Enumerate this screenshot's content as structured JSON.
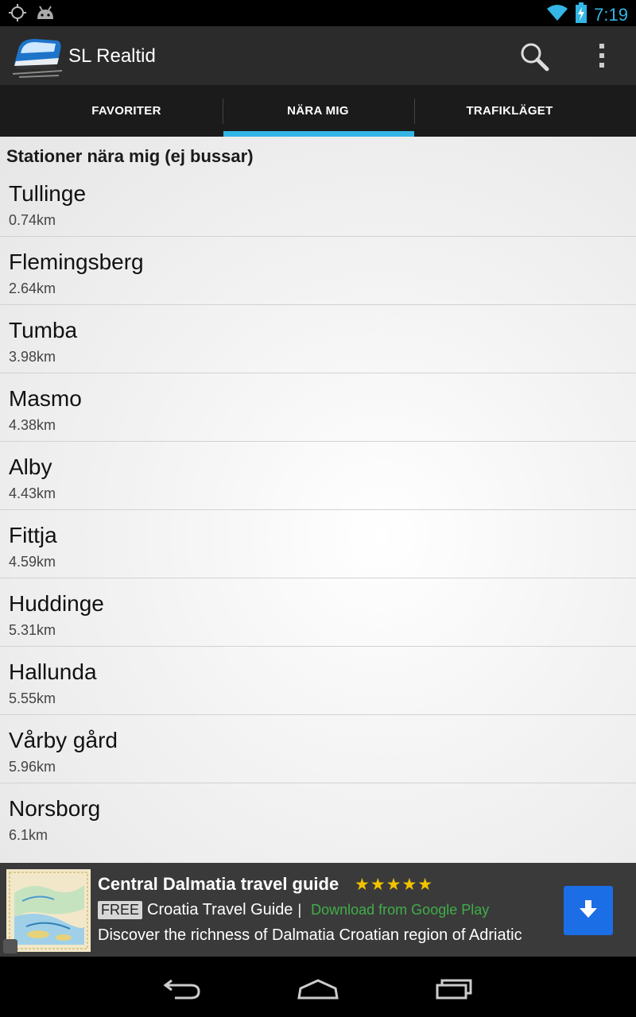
{
  "status_bar": {
    "time": "7:19",
    "left_icons": [
      "gps-icon",
      "android-icon"
    ],
    "right_icons": [
      "wifi-icon",
      "battery-charging-icon"
    ]
  },
  "action_bar": {
    "title": "SL Realtid",
    "actions": [
      "search-icon",
      "overflow-menu-icon"
    ]
  },
  "tabs": {
    "items": [
      {
        "label": "FAVORITER",
        "selected": false
      },
      {
        "label": "NÄRA MIG",
        "selected": true
      },
      {
        "label": "TRAFIKLÄGET",
        "selected": false
      }
    ],
    "accent": "#33b5e5"
  },
  "content": {
    "section_title": "Stationer nära mig (ej bussar)",
    "stations": [
      {
        "name": "Tullinge",
        "distance": "0.74km"
      },
      {
        "name": "Flemingsberg",
        "distance": "2.64km"
      },
      {
        "name": "Tumba",
        "distance": "3.98km"
      },
      {
        "name": "Masmo",
        "distance": "4.38km"
      },
      {
        "name": "Alby",
        "distance": "4.43km"
      },
      {
        "name": "Fittja",
        "distance": "4.59km"
      },
      {
        "name": "Huddinge",
        "distance": "5.31km"
      },
      {
        "name": "Hallunda",
        "distance": "5.55km"
      },
      {
        "name": "Vårby gård",
        "distance": "5.96km"
      },
      {
        "name": "Norsborg",
        "distance": "6.1km"
      }
    ]
  },
  "ad": {
    "title": "Central Dalmatia travel guide",
    "stars": "★★★★★",
    "free_badge": "FREE",
    "subtitle": "Croatia Travel Guide",
    "separator": "|",
    "cta_text": "Download from Google Play",
    "description": "Discover the richness of Dalmatia Croatian region of Adriatic",
    "button_color": "#1c6ee6",
    "cta_color": "#3fae49"
  },
  "nav_bar": {
    "buttons": [
      "back-icon",
      "home-icon",
      "recents-icon"
    ]
  }
}
